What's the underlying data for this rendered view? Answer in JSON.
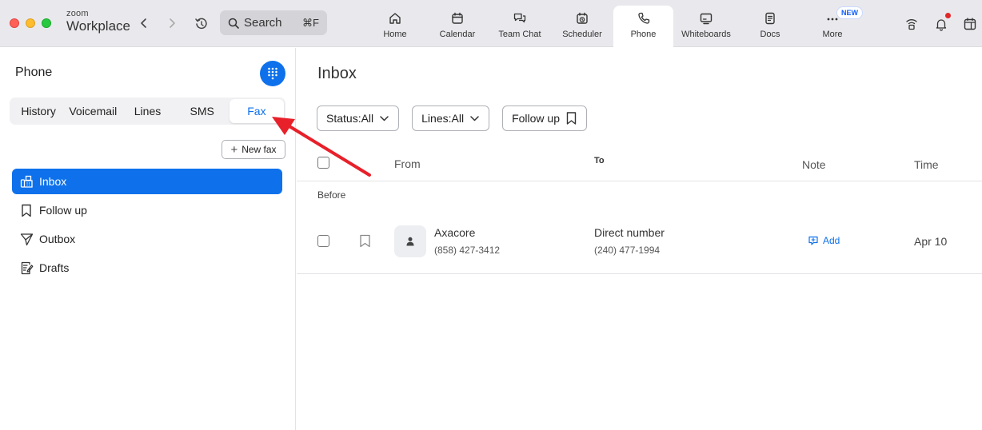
{
  "app": {
    "brand_small": "zoom",
    "brand_big": "Workplace"
  },
  "search": {
    "label": "Search",
    "shortcut": "⌘F"
  },
  "top_tabs": [
    {
      "label": "Home",
      "icon": "home-icon"
    },
    {
      "label": "Calendar",
      "icon": "calendar-icon"
    },
    {
      "label": "Team Chat",
      "icon": "chat-icon"
    },
    {
      "label": "Scheduler",
      "icon": "scheduler-icon"
    },
    {
      "label": "Phone",
      "icon": "phone-icon",
      "active": true
    },
    {
      "label": "Whiteboards",
      "icon": "whiteboard-icon"
    },
    {
      "label": "Docs",
      "icon": "docs-icon"
    },
    {
      "label": "More",
      "icon": "more-icon",
      "badge": "NEW"
    }
  ],
  "sidebar": {
    "title": "Phone",
    "tabs": [
      {
        "label": "History"
      },
      {
        "label": "Voicemail"
      },
      {
        "label": "Lines"
      },
      {
        "label": "SMS"
      },
      {
        "label": "Fax",
        "active": true
      }
    ],
    "new_fax_label": "New fax",
    "folders": [
      {
        "label": "Inbox",
        "icon": "fax-inbox-icon",
        "active": true
      },
      {
        "label": "Follow up",
        "icon": "bookmark-icon"
      },
      {
        "label": "Outbox",
        "icon": "send-icon"
      },
      {
        "label": "Drafts",
        "icon": "draft-icon"
      }
    ]
  },
  "main": {
    "title": "Inbox",
    "filters": [
      {
        "label": "Status:All",
        "icon": "chevron-down-icon"
      },
      {
        "label": "Lines:All",
        "icon": "chevron-down-icon"
      },
      {
        "label": "Follow up",
        "icon": "bookmark-icon"
      }
    ],
    "columns": {
      "from": "From",
      "to": "To",
      "note": "Note",
      "time": "Time"
    },
    "section_label": "Before",
    "rows": [
      {
        "from_name": "Axacore",
        "from_number": "(858) 427-3412",
        "to_name": "Direct number",
        "to_number": "(240) 477-1994",
        "note_action": "Add",
        "time": "Apr 10"
      }
    ]
  },
  "colors": {
    "accent": "#0e71eb",
    "annotation_arrow": "#e8202a",
    "titlebar": "#e9e9ed"
  }
}
